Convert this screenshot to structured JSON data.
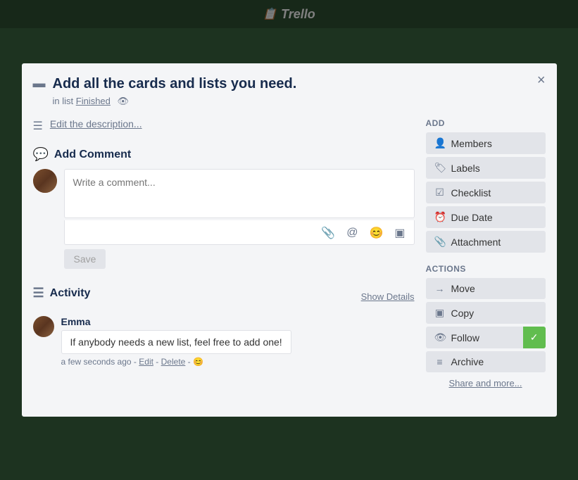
{
  "app": {
    "name": "Trello"
  },
  "modal": {
    "title": "Add all the cards and lists you need.",
    "list_prefix": "in list",
    "list_name": "Finished",
    "close_label": "×",
    "description_link": "Edit the description...",
    "add_comment_title": "Add Comment",
    "comment_placeholder": "Write a comment...",
    "save_label": "Save",
    "activity_title": "Activity",
    "show_details_label": "Show Details",
    "activity_items": [
      {
        "user": "Emma",
        "comment": "If anybody needs a new list, feel free to add one!",
        "time": "a few seconds ago",
        "edit_label": "Edit",
        "delete_label": "Delete"
      }
    ]
  },
  "sidebar": {
    "add_title": "Add",
    "actions_title": "Actions",
    "add_buttons": [
      {
        "id": "members",
        "label": "Members",
        "icon": "👤"
      },
      {
        "id": "labels",
        "label": "Labels",
        "icon": "🏷"
      },
      {
        "id": "checklist",
        "label": "Checklist",
        "icon": "☑"
      },
      {
        "id": "due-date",
        "label": "Due Date",
        "icon": "⏰"
      },
      {
        "id": "attachment",
        "label": "Attachment",
        "icon": "📎"
      }
    ],
    "action_buttons": [
      {
        "id": "move",
        "label": "Move",
        "icon": "→"
      },
      {
        "id": "copy",
        "label": "Copy",
        "icon": "▣"
      },
      {
        "id": "follow",
        "label": "Follow",
        "icon": "👁",
        "active": true
      },
      {
        "id": "archive",
        "label": "Archive",
        "icon": "≡"
      }
    ],
    "share_more_label": "Share and more..."
  }
}
